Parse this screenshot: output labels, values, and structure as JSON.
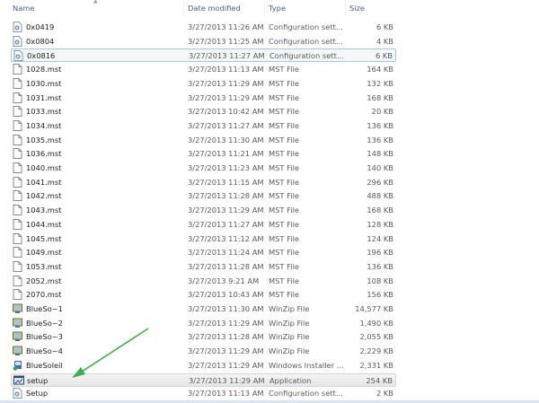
{
  "header": {
    "name": "Name",
    "date": "Date modified",
    "type": "Type",
    "size": "Size"
  },
  "colors": {
    "arrow": "#3cb04a",
    "selection_border": "#a8c8ea"
  },
  "files": [
    {
      "name": "0x0419",
      "date": "3/27/2013 11:26 AM",
      "type": "Configuration sett...",
      "size": "6 KB",
      "icon": "config"
    },
    {
      "name": "0x0804",
      "date": "3/27/2013 11:25 AM",
      "type": "Configuration sett...",
      "size": "4 KB",
      "icon": "config"
    },
    {
      "name": "0x0816",
      "date": "3/27/2013 11:27 AM",
      "type": "Configuration sett...",
      "size": "6 KB",
      "icon": "config",
      "state": "selected"
    },
    {
      "name": "1028.mst",
      "date": "3/27/2013 11:13 AM",
      "type": "MST File",
      "size": "164 KB",
      "icon": "file"
    },
    {
      "name": "1030.mst",
      "date": "3/27/2013 11:29 AM",
      "type": "MST File",
      "size": "132 KB",
      "icon": "file"
    },
    {
      "name": "1031.mst",
      "date": "3/27/2013 11:29 AM",
      "type": "MST File",
      "size": "168 KB",
      "icon": "file"
    },
    {
      "name": "1033.mst",
      "date": "3/27/2013 10:42 AM",
      "type": "MST File",
      "size": "20 KB",
      "icon": "file"
    },
    {
      "name": "1034.mst",
      "date": "3/27/2013 11:27 AM",
      "type": "MST File",
      "size": "136 KB",
      "icon": "file"
    },
    {
      "name": "1035.mst",
      "date": "3/27/2013 11:30 AM",
      "type": "MST File",
      "size": "136 KB",
      "icon": "file"
    },
    {
      "name": "1036.mst",
      "date": "3/27/2013 11:21 AM",
      "type": "MST File",
      "size": "148 KB",
      "icon": "file"
    },
    {
      "name": "1040.mst",
      "date": "3/27/2013 11:23 AM",
      "type": "MST File",
      "size": "140 KB",
      "icon": "file"
    },
    {
      "name": "1041.mst",
      "date": "3/27/2013 11:15 AM",
      "type": "MST File",
      "size": "296 KB",
      "icon": "file"
    },
    {
      "name": "1042.mst",
      "date": "3/27/2013 11:28 AM",
      "type": "MST File",
      "size": "488 KB",
      "icon": "file"
    },
    {
      "name": "1043.mst",
      "date": "3/27/2013 11:29 AM",
      "type": "MST File",
      "size": "168 KB",
      "icon": "file"
    },
    {
      "name": "1044.mst",
      "date": "3/27/2013 11:27 AM",
      "type": "MST File",
      "size": "128 KB",
      "icon": "file"
    },
    {
      "name": "1045.mst",
      "date": "3/27/2013 11:12 AM",
      "type": "MST File",
      "size": "124 KB",
      "icon": "file"
    },
    {
      "name": "1049.mst",
      "date": "3/27/2013 11:24 AM",
      "type": "MST File",
      "size": "196 KB",
      "icon": "file"
    },
    {
      "name": "1053.mst",
      "date": "3/27/2013 11:28 AM",
      "type": "MST File",
      "size": "136 KB",
      "icon": "file"
    },
    {
      "name": "2052.mst",
      "date": "3/27/2013 9:21 AM",
      "type": "MST File",
      "size": "108 KB",
      "icon": "file"
    },
    {
      "name": "2070.mst",
      "date": "3/27/2013 10:43 AM",
      "type": "MST File",
      "size": "156 KB",
      "icon": "file"
    },
    {
      "name": "BlueSo~1",
      "date": "3/27/2013 11:30 AM",
      "type": "WinZip File",
      "size": "14,577 KB",
      "icon": "winzip"
    },
    {
      "name": "BlueSo~2",
      "date": "3/27/2013 11:29 AM",
      "type": "WinZip File",
      "size": "1,490 KB",
      "icon": "winzip"
    },
    {
      "name": "BlueSo~3",
      "date": "3/27/2013 11:28 AM",
      "type": "WinZip File",
      "size": "2,055 KB",
      "icon": "winzip"
    },
    {
      "name": "BlueSo~4",
      "date": "3/27/2013 11:29 AM",
      "type": "WinZip File",
      "size": "2,229 KB",
      "icon": "winzip"
    },
    {
      "name": "BlueSoleil",
      "date": "3/27/2013 11:29 AM",
      "type": "Windows Installer ...",
      "size": "2,331 KB",
      "icon": "installer"
    },
    {
      "name": "setup",
      "date": "3/27/2013 11:29 AM",
      "type": "Application",
      "size": "254 KB",
      "icon": "application",
      "state": "highlighted"
    },
    {
      "name": "Setup",
      "date": "3/27/2013 11:13 AM",
      "type": "Configuration sett...",
      "size": "2 KB",
      "icon": "config"
    }
  ]
}
